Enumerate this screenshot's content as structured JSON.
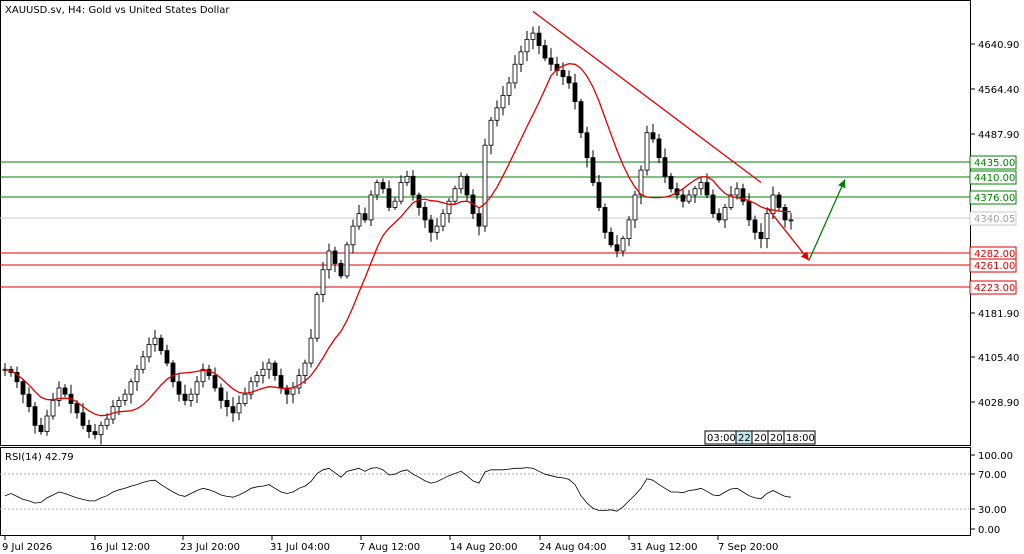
{
  "header": {
    "title": "XAUUSD.sv, H4:  Gold vs United States Dollar"
  },
  "indicator": {
    "label": "RSI(14) 42.79"
  },
  "price_axis": {
    "ticks": [
      "4640.90",
      "4564.40",
      "4487.90",
      "4181.90",
      "4105.40",
      "4028.90"
    ],
    "current_price": "4340.05"
  },
  "levels": {
    "green": [
      "4435.00",
      "4410.00",
      "4376.00"
    ],
    "red": [
      "4282.00",
      "4261.00",
      "4223.00"
    ],
    "green_color": "#008000",
    "red_color": "#e00000"
  },
  "rsi_axis": {
    "ticks": [
      "100.00",
      "70.00",
      "30.00",
      "0.00"
    ]
  },
  "time_axis": {
    "labels": [
      "9 Jul 2026",
      "16 Jul 12:00",
      "23 Jul 20:00",
      "31 Jul 04:00",
      "7 Aug 12:00",
      "14 Aug 20:00",
      "24 Aug 04:00",
      "31 Aug 12:00",
      "7 Sep 20:00"
    ]
  },
  "time_scroll": {
    "items": [
      "03:00",
      "22",
      "20",
      "20",
      "18:00"
    ]
  },
  "chart_data": {
    "type": "candlestick",
    "symbol": "XAUUSD.sv",
    "timeframe": "H4",
    "ylim": [
      3980,
      4690
    ],
    "close": [
      4100,
      4095,
      4080,
      4060,
      4040,
      4010,
      4000,
      4025,
      4050,
      4070,
      4060,
      4045,
      4030,
      4010,
      4000,
      3995,
      4010,
      4020,
      4040,
      4050,
      4060,
      4080,
      4100,
      4120,
      4140,
      4150,
      4130,
      4110,
      4080,
      4060,
      4050,
      4060,
      4080,
      4100,
      4090,
      4070,
      4050,
      4040,
      4030,
      4045,
      4060,
      4080,
      4090,
      4100,
      4110,
      4090,
      4070,
      4060,
      4070,
      4090,
      4110,
      4150,
      4220,
      4260,
      4290,
      4270,
      4250,
      4300,
      4330,
      4350,
      4340,
      4380,
      4400,
      4390,
      4360,
      4370,
      4400,
      4410,
      4380,
      4360,
      4340,
      4320,
      4330,
      4350,
      4370,
      4390,
      4410,
      4380,
      4350,
      4330,
      4460,
      4500,
      4520,
      4540,
      4560,
      4590,
      4610,
      4630,
      4640,
      4620,
      4600,
      4590,
      4580,
      4570,
      4560,
      4530,
      4480,
      4440,
      4400,
      4360,
      4320,
      4300,
      4290,
      4310,
      4340,
      4380,
      4420,
      4480,
      4470,
      4440,
      4410,
      4390,
      4380,
      4370,
      4380,
      4390,
      4400,
      4380,
      4350,
      4340,
      4360,
      4380,
      4390,
      4370,
      4340,
      4320,
      4310,
      4350,
      4380,
      4360,
      4340,
      4340
    ],
    "ma_color": "#e00000",
    "trendline": {
      "from": [
        88,
        4675
      ],
      "to": [
        126,
        4400
      ]
    },
    "projection_down": {
      "from": [
        127,
        4360
      ],
      "to": [
        134,
        4275
      ]
    },
    "projection_up": {
      "from": [
        134,
        4275
      ],
      "to": [
        140,
        4405
      ]
    },
    "rsi": {
      "ylim": [
        0,
        100
      ],
      "levels": [
        70,
        30
      ],
      "values": [
        45,
        48,
        44,
        40,
        38,
        35,
        36,
        42,
        46,
        50,
        48,
        45,
        42,
        40,
        38,
        38,
        42,
        45,
        50,
        53,
        55,
        58,
        60,
        63,
        65,
        66,
        60,
        55,
        50,
        46,
        44,
        48,
        52,
        55,
        53,
        50,
        46,
        44,
        43,
        46,
        50,
        55,
        57,
        58,
        60,
        55,
        50,
        48,
        50,
        55,
        58,
        64,
        75,
        80,
        82,
        76,
        70,
        78,
        80,
        82,
        78,
        82,
        83,
        80,
        73,
        74,
        78,
        80,
        74,
        70,
        65,
        62,
        64,
        68,
        72,
        75,
        78,
        72,
        65,
        62,
        77,
        80,
        80,
        80,
        81,
        82,
        82,
        83,
        82,
        78,
        74,
        72,
        70,
        69,
        67,
        60,
        45,
        35,
        28,
        25,
        25,
        26,
        24,
        30,
        38,
        46,
        55,
        68,
        66,
        60,
        55,
        50,
        50,
        49,
        52,
        53,
        55,
        51,
        46,
        45,
        50,
        54,
        55,
        50,
        45,
        42,
        41,
        48,
        52,
        48,
        44,
        43
      ]
    }
  }
}
